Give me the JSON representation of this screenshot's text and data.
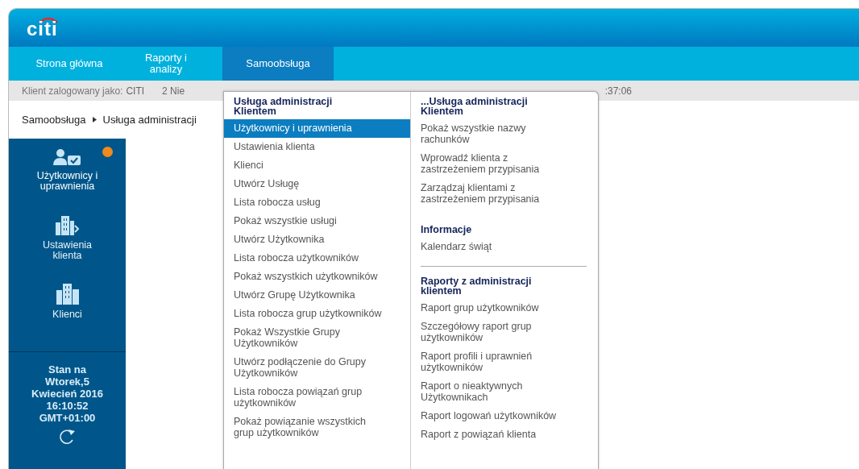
{
  "logo": "citi",
  "nav": [
    {
      "label": "Strona główna",
      "selected": false
    },
    {
      "label": "Raporty i analizy",
      "selected": false
    },
    {
      "label": "Samoobsługa",
      "selected": true
    }
  ],
  "info_bar": {
    "client_label": "Klient zalogowany jako:",
    "client": "CITI",
    "date": "2 Nie",
    "time": ":37:06"
  },
  "breadcrumb": [
    "Samoobsługa",
    "Usługa administracji"
  ],
  "sidebar": {
    "items": [
      {
        "kind": "users",
        "label": "Użytkownicy i uprawnienia",
        "badge": true,
        "color": "#f08a1c"
      },
      {
        "kind": "settings",
        "label": "Ustawienia klienta",
        "badge": false
      },
      {
        "kind": "clients",
        "label": "Klienci",
        "badge": false
      }
    ],
    "status": [
      "Stan na",
      "Wtorek,5",
      "Kwiecień 2016",
      "16:10:52",
      "GMT+01:00"
    ]
  },
  "menu": {
    "columns": [
      {
        "sections": [
          {
            "heading": "Usługa administracji Klientem",
            "divider": false,
            "items": [
              {
                "label": "Użytkownicy i uprawnienia",
                "selected": true
              },
              {
                "label": "Ustawienia klienta",
                "selected": false
              },
              {
                "label": "Klienci",
                "selected": false
              },
              {
                "label": "Utwórz Usługę",
                "selected": false
              },
              {
                "label": "Lista robocza usług",
                "selected": false
              },
              {
                "label": "Pokaż wszystkie usługi",
                "selected": false
              },
              {
                "label": "Utwórz Użytkownika",
                "selected": false
              },
              {
                "label": "Lista robocza użytkowników",
                "selected": false
              },
              {
                "label": "Pokaż wszystkich użytkowników",
                "selected": false
              },
              {
                "label": "Utwórz Grupę Użytkownika",
                "selected": false
              },
              {
                "label": "Lista robocza grup użytkowników",
                "selected": false
              },
              {
                "label": "Pokaż Wszystkie Grupy Użytkowników",
                "selected": false
              },
              {
                "label": "Utwórz podłączenie do Grupy Użytkowników",
                "selected": false
              },
              {
                "label": "Lista robocza powiązań grup użytkowników",
                "selected": false
              },
              {
                "label": "Pokaż powiązanie wszystkich grup użytkowników",
                "selected": false
              }
            ]
          }
        ]
      },
      {
        "sections": [
          {
            "heading": "...Usługa administracji Klientem",
            "divider": false,
            "items": [
              {
                "label": "Pokaż wszystkie nazwy rachunków",
                "selected": false
              },
              {
                "label": "Wprowadź klienta z zastrzeżeniem przypisania",
                "selected": false
              },
              {
                "label": "Zarządzaj klientami z zastrzeżeniem przypisania",
                "selected": false
              }
            ]
          },
          {
            "heading": "Informacje",
            "divider": false,
            "items": [
              {
                "label": "Kalendarz świąt",
                "selected": false
              }
            ]
          },
          {
            "heading": "Raporty z administracji klientem",
            "divider": true,
            "items": [
              {
                "label": "Raport grup użytkowników",
                "selected": false
              },
              {
                "label": "Szczegółowy raport grup użytkowników",
                "selected": false
              },
              {
                "label": "Raport profili i uprawnień użytkowników",
                "selected": false
              },
              {
                "label": "Raport o nieaktywnych Użytkownikach",
                "selected": false
              },
              {
                "label": "Raport logowań użytkowników",
                "selected": false
              },
              {
                "label": "Raport z powiązań klienta",
                "selected": false
              }
            ]
          }
        ]
      }
    ]
  }
}
